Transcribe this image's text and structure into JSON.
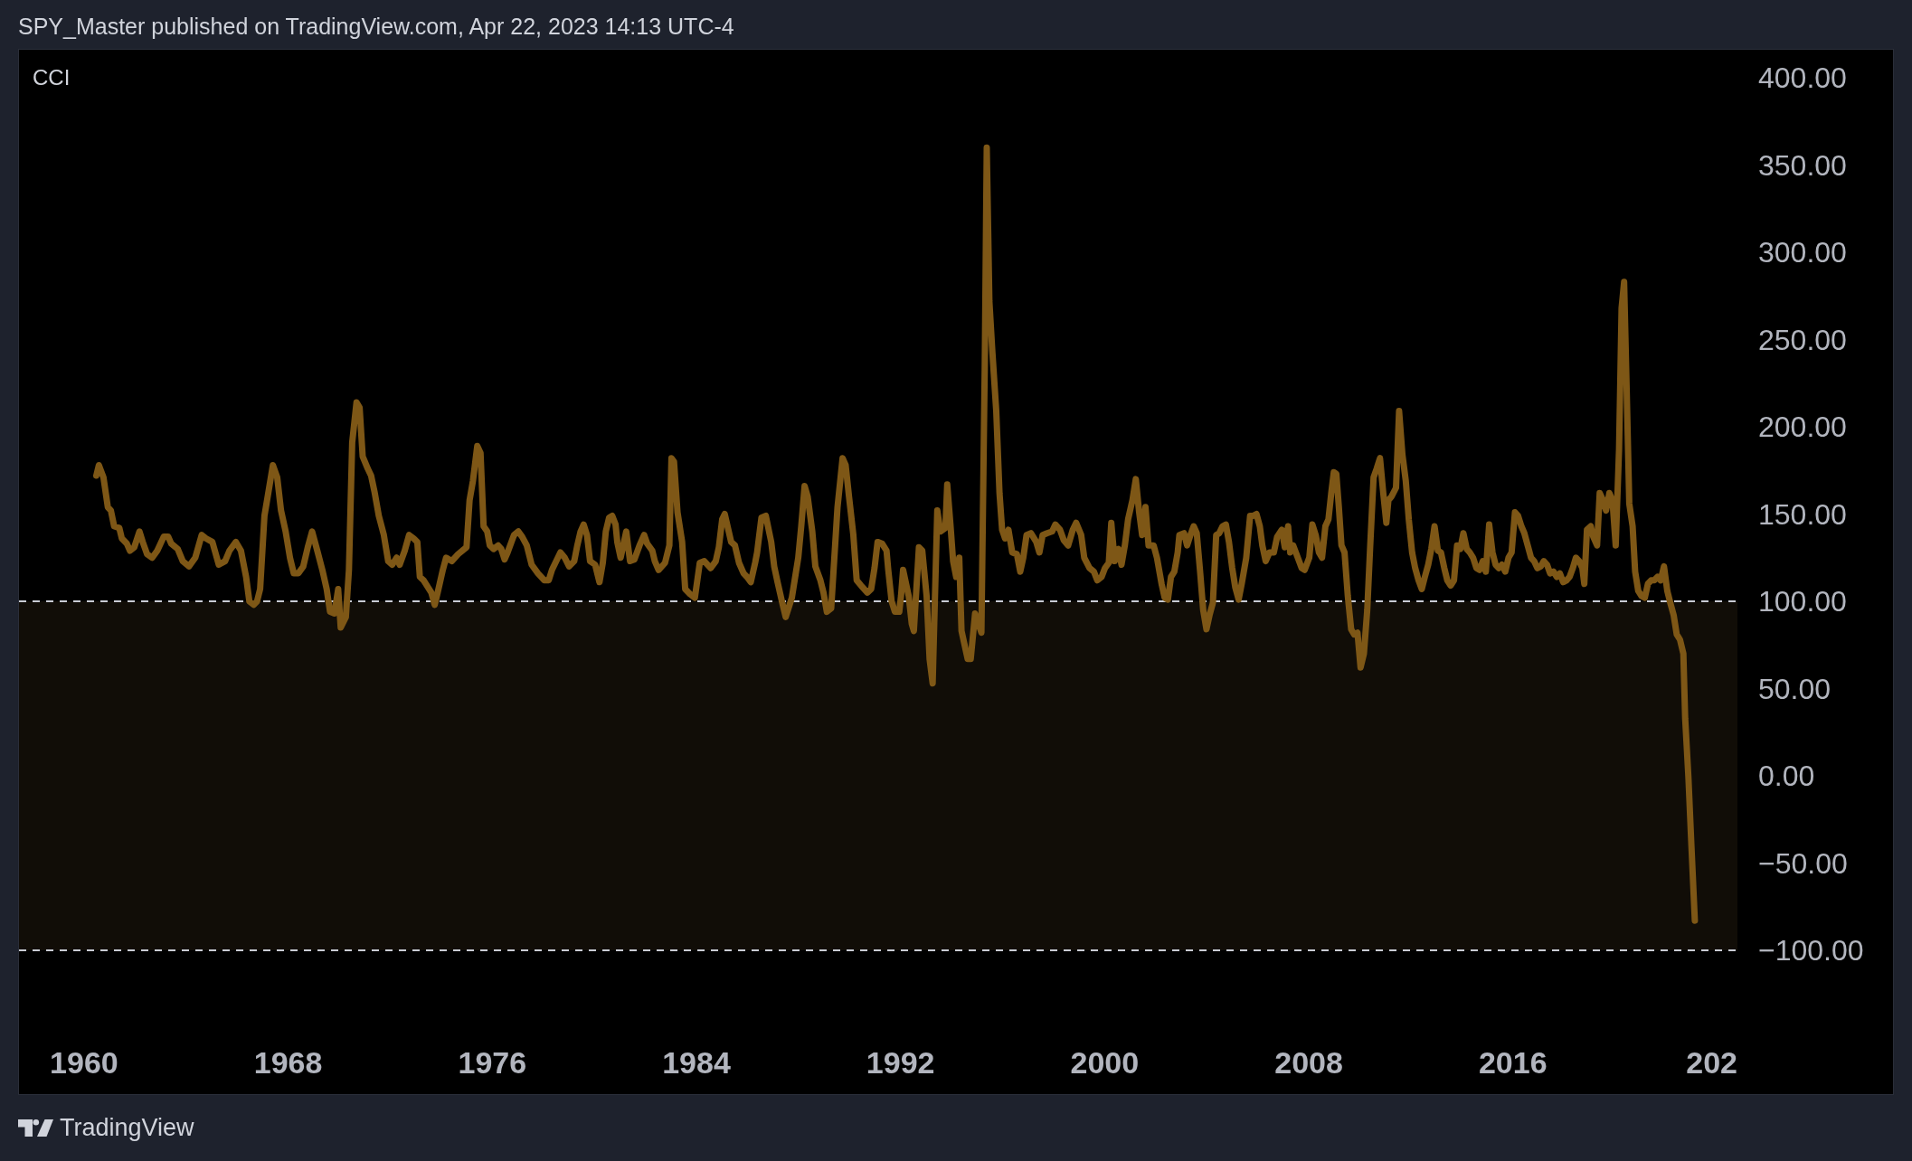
{
  "header": {
    "text": "SPY_Master published on TradingView.com, Apr 22, 2023 14:13 UTC-4"
  },
  "chart": {
    "chart_data": {
      "type": "line",
      "x": [
        1960.48,
        1960.58,
        1960.76,
        1960.93,
        1961.05,
        1961.18,
        1961.38,
        1961.48,
        1961.68,
        1961.8,
        1961.97,
        1962.17,
        1962.3,
        1962.47,
        1962.67,
        1962.87,
        1963.12,
        1963.3,
        1963.42,
        1963.67,
        1963.87,
        1964.11,
        1964.36,
        1964.61,
        1964.78,
        1965.03,
        1965.28,
        1965.53,
        1965.7,
        1965.95,
        1966.15,
        1966.35,
        1966.48,
        1966.65,
        1966.78,
        1966.9,
        1967.07,
        1967.22,
        1967.4,
        1967.57,
        1967.72,
        1967.9,
        1968.07,
        1968.22,
        1968.4,
        1968.59,
        1968.77,
        1968.94,
        1969.14,
        1969.34,
        1969.51,
        1969.64,
        1969.81,
        1969.96,
        1970.06,
        1970.26,
        1970.38,
        1970.51,
        1970.68,
        1970.8,
        1970.92,
        1971.12,
        1971.25,
        1971.38,
        1971.55,
        1971.75,
        1971.92,
        1972.08,
        1972.25,
        1972.37,
        1972.57,
        1972.74,
        1972.92,
        1973.06,
        1973.16,
        1973.31,
        1973.61,
        1973.74,
        1973.86,
        1974.06,
        1974.19,
        1974.41,
        1974.66,
        1974.99,
        1975.11,
        1975.24,
        1975.41,
        1975.54,
        1975.66,
        1975.8,
        1975.9,
        1976.05,
        1976.23,
        1976.35,
        1976.48,
        1976.6,
        1976.85,
        1977.02,
        1977.17,
        1977.35,
        1977.54,
        1977.79,
        1978.04,
        1978.21,
        1978.34,
        1978.67,
        1978.84,
        1979.01,
        1979.21,
        1979.33,
        1979.46,
        1979.58,
        1979.71,
        1979.83,
        1980.03,
        1980.2,
        1980.33,
        1980.45,
        1980.58,
        1980.7,
        1980.83,
        1980.9,
        1981.03,
        1981.25,
        1981.4,
        1981.57,
        1981.77,
        1981.95,
        1982.07,
        1982.27,
        1982.37,
        1982.52,
        1982.77,
        1982.94,
        1983.02,
        1983.12,
        1983.26,
        1983.44,
        1983.56,
        1983.76,
        1983.94,
        1984.13,
        1984.31,
        1984.56,
        1984.76,
        1984.88,
        1985.01,
        1985.11,
        1985.36,
        1985.51,
        1985.67,
        1985.85,
        1985.98,
        1986.13,
        1986.3,
        1986.38,
        1986.55,
        1986.72,
        1986.93,
        1987.05,
        1987.18,
        1987.35,
        1987.5,
        1987.74,
        1987.99,
        1988.11,
        1988.24,
        1988.36,
        1988.54,
        1988.66,
        1988.86,
        1988.98,
        1989.11,
        1989.28,
        1989.53,
        1989.73,
        1989.85,
        1989.98,
        1990.15,
        1990.28,
        1990.45,
        1990.7,
        1990.85,
        1990.98,
        1991.1,
        1991.28,
        1991.45,
        1991.52,
        1991.65,
        1991.78,
        1991.95,
        1992.02,
        1992.1,
        1992.32,
        1992.44,
        1992.52,
        1992.72,
        1992.85,
        1993.02,
        1993.14,
        1993.26,
        1993.44,
        1993.56,
        1993.76,
        1993.83,
        1993.96,
        1994.06,
        1994.18,
        1994.3,
        1994.39,
        1994.63,
        1994.75,
        1994.92,
        1995.17,
        1995.3,
        1995.38,
        1995.48,
        1995.6,
        1995.75,
        1995.88,
        1995.98,
        1996.1,
        1996.23,
        1996.38,
        1996.56,
        1996.69,
        1996.81,
        1996.94,
        1997.11,
        1997.32,
        1997.44,
        1997.57,
        1997.74,
        1997.94,
        1998.07,
        1998.25,
        1998.4,
        1998.57,
        1998.75,
        1998.88,
        1999.08,
        1999.2,
        1999.41,
        1999.58,
        1999.71,
        1999.88,
        2000.01,
        2000.16,
        2000.26,
        2000.39,
        2000.54,
        2000.66,
        2000.79,
        2000.92,
        2001.09,
        2001.22,
        2001.35,
        2001.47,
        2001.6,
        2001.72,
        2001.92,
        2002.05,
        2002.23,
        2002.35,
        2002.48,
        2002.6,
        2002.73,
        2002.86,
        2002.93,
        2003.11,
        2003.23,
        2003.36,
        2003.49,
        2003.61,
        2003.74,
        2003.86,
        2003.99,
        2004.11,
        2004.24,
        2004.37,
        2004.49,
        2004.62,
        2004.75,
        2004.87,
        2005.0,
        2005.12,
        2005.25,
        2005.37,
        2005.55,
        2005.7,
        2005.83,
        2005.95,
        2006.08,
        2006.18,
        2006.31,
        2006.46,
        2006.63,
        2006.76,
        2006.94,
        2007.06,
        2007.19,
        2007.27,
        2007.39,
        2007.57,
        2007.72,
        2007.84,
        2008.02,
        2008.14,
        2008.27,
        2008.4,
        2008.52,
        2008.65,
        2008.77,
        2008.88,
        2008.98,
        2009.08,
        2009.18,
        2009.28,
        2009.4,
        2009.53,
        2009.66,
        2009.78,
        2009.91,
        2010.03,
        2010.16,
        2010.29,
        2010.41,
        2010.54,
        2010.66,
        2010.79,
        2010.92,
        2011.04,
        2011.12,
        2011.24,
        2011.42,
        2011.54,
        2011.67,
        2011.8,
        2011.92,
        2012.05,
        2012.17,
        2012.3,
        2012.43,
        2012.55,
        2012.68,
        2012.8,
        2012.93,
        2013.06,
        2013.18,
        2013.31,
        2013.43,
        2013.56,
        2013.69,
        2013.81,
        2013.94,
        2014.06,
        2014.19,
        2014.31,
        2014.44,
        2014.57,
        2014.69,
        2014.82,
        2014.94,
        2015.07,
        2015.2,
        2015.32,
        2015.45,
        2015.57,
        2015.7,
        2015.83,
        2015.95,
        2016.08,
        2016.2,
        2016.33,
        2016.45,
        2016.58,
        2016.71,
        2016.83,
        2016.96,
        2017.09,
        2017.21,
        2017.34,
        2017.46,
        2017.59,
        2017.72,
        2017.84,
        2017.97,
        2018.1,
        2018.22,
        2018.35,
        2018.47,
        2018.6,
        2018.72,
        2018.8,
        2018.9,
        2019.05,
        2019.15,
        2019.3,
        2019.4,
        2019.53,
        2019.65,
        2019.78,
        2019.9,
        2020.03,
        2020.16,
        2020.26,
        2020.36,
        2020.46,
        2020.56,
        2020.69,
        2020.79,
        2020.91,
        2021.04,
        2021.17,
        2021.29,
        2021.42,
        2021.54,
        2021.67,
        2021.79,
        2021.92,
        2022.05,
        2022.17,
        2022.3,
        2022.42,
        2022.55,
        2022.68,
        2022.75,
        2022.88,
        2023.0,
        2023.13
      ],
      "series": [
        {
          "name": "CCI",
          "color": "#7e5716",
          "values": [
            172,
            178,
            171,
            154,
            152,
            143,
            142,
            136,
            133,
            129,
            131,
            140,
            134,
            127,
            125,
            129,
            137,
            137,
            133,
            130,
            123,
            120,
            125,
            138,
            136,
            134,
            121,
            123,
            129,
            134,
            129,
            114,
            100,
            98,
            100,
            107,
            149,
            162,
            178,
            171,
            152,
            140,
            125,
            116,
            116,
            120,
            131,
            140,
            129,
            118,
            107,
            94,
            93,
            107,
            85,
            91,
            118,
            191,
            214,
            211,
            183,
            176,
            172,
            163,
            149,
            138,
            123,
            121,
            125,
            121,
            129,
            138,
            136,
            134,
            114,
            112,
            105,
            98,
            105,
            118,
            125,
            123,
            127,
            131,
            158,
            169,
            189,
            185,
            143,
            140,
            132,
            130,
            132,
            130,
            124,
            128,
            138,
            140,
            137,
            132,
            121,
            116,
            112,
            112,
            118,
            128,
            125,
            120,
            123,
            132,
            140,
            144,
            138,
            123,
            121,
            111,
            122,
            140,
            148,
            149,
            144,
            134,
            125,
            140,
            123,
            124,
            132,
            138,
            133,
            129,
            123,
            118,
            122,
            132,
            182,
            180,
            151,
            134,
            107,
            104,
            102,
            122,
            123,
            119,
            123,
            131,
            147,
            150,
            134,
            132,
            122,
            116,
            114,
            111,
            122,
            128,
            148,
            149,
            134,
            120,
            111,
            100,
            91,
            102,
            125,
            143,
            166,
            160,
            140,
            120,
            112,
            105,
            94,
            96,
            154,
            182,
            178,
            160,
            138,
            112,
            109,
            105,
            107,
            119,
            134,
            133,
            129,
            118,
            100,
            94,
            94,
            103,
            118,
            103,
            87,
            83,
            131,
            129,
            103,
            67,
            53,
            152,
            140,
            142,
            167,
            143,
            123,
            114,
            125,
            83,
            67,
            67,
            93,
            82,
            235,
            360,
            272,
            243,
            209,
            162,
            141,
            136,
            141,
            128,
            127,
            117,
            125,
            138,
            139,
            134,
            128,
            138,
            139,
            140,
            144,
            141,
            135,
            132,
            141,
            145,
            138,
            125,
            119,
            117,
            112,
            114,
            119,
            122,
            145,
            123,
            130,
            121,
            132,
            147,
            158,
            170,
            151,
            138,
            154,
            132,
            132,
            125,
            110,
            102,
            101,
            114,
            117,
            128,
            138,
            139,
            132,
            138,
            143,
            139,
            117,
            95,
            84,
            92,
            99,
            138,
            139,
            143,
            144,
            134,
            119,
            108,
            101,
            110,
            125,
            149,
            149,
            150,
            143,
            132,
            123,
            128,
            128,
            137,
            141,
            131,
            143,
            128,
            132,
            125,
            119,
            118,
            125,
            144,
            138,
            128,
            125,
            143,
            147,
            162,
            174,
            173,
            154,
            132,
            128,
            103,
            84,
            81,
            82,
            62,
            70,
            95,
            132,
            171,
            176,
            182,
            162,
            145,
            158,
            160,
            165,
            209,
            184,
            169,
            147,
            128,
            119,
            112,
            107,
            114,
            121,
            130,
            143,
            129,
            128,
            119,
            112,
            109,
            112,
            132,
            130,
            139,
            130,
            128,
            125,
            119,
            118,
            123,
            117,
            144,
            128,
            121,
            119,
            121,
            117,
            125,
            128,
            151,
            149,
            143,
            139,
            132,
            125,
            123,
            119,
            120,
            123,
            121,
            116,
            117,
            114,
            116,
            111,
            112,
            114,
            119,
            125,
            123,
            119,
            110,
            141,
            143,
            137,
            132,
            162,
            158,
            152,
            162,
            158,
            132,
            187,
            268,
            283,
            220,
            156,
            143,
            117,
            106,
            103,
            102,
            110,
            112,
            112,
            114,
            112,
            120,
            106,
            99,
            92,
            81,
            78,
            70,
            33,
            -1,
            -41,
            -83
          ]
        }
      ],
      "xlim": [
        1957.45,
        2024.8
      ],
      "ylim": [
        -100,
        400
      ],
      "xticks": [
        1960,
        1968,
        1976,
        1984,
        1992,
        2000,
        2008,
        2016
      ],
      "yticks": [
        {
          "value": 400,
          "label": "400.00"
        },
        {
          "value": 350,
          "label": "350.00"
        },
        {
          "value": 300,
          "label": "300.00"
        },
        {
          "value": 250,
          "label": "250.00"
        },
        {
          "value": 200,
          "label": "200.00"
        },
        {
          "value": 150,
          "label": "150.00"
        },
        {
          "value": 100,
          "label": "100.00"
        },
        {
          "value": 50,
          "label": "50.00"
        },
        {
          "value": 0,
          "label": "0.00"
        },
        {
          "value": -50,
          "label": "−50.00"
        },
        {
          "value": -100,
          "label": "−100.00"
        }
      ],
      "bands": [
        {
          "axis": "y",
          "from": -100,
          "to": 100
        }
      ]
    },
    "edge_time_label": "202"
  },
  "footer": {
    "brand": "TradingView"
  }
}
